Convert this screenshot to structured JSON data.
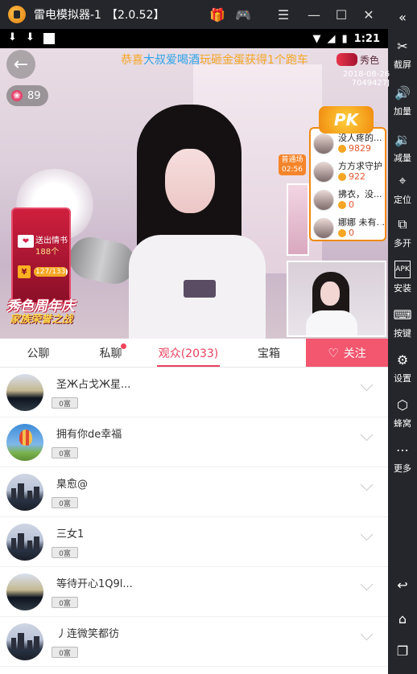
{
  "window": {
    "title": "雷电模拟器-1",
    "version": "【2.0.52】",
    "buttons": [
      "gift-icon",
      "gamepad-icon",
      "menu-icon",
      "minimize-icon",
      "maximize-icon",
      "close-icon"
    ]
  },
  "rail": {
    "items": [
      {
        "label": "截屏",
        "icon": "scissors-icon"
      },
      {
        "label": "加量",
        "icon": "volume-up-icon"
      },
      {
        "label": "减量",
        "icon": "volume-down-icon"
      },
      {
        "label": "定位",
        "icon": "location-icon"
      },
      {
        "label": "多开",
        "icon": "multi-instance-icon"
      },
      {
        "label": "安装",
        "icon": "apk-install-icon"
      },
      {
        "label": "按键",
        "icon": "keyboard-icon"
      },
      {
        "label": "设置",
        "icon": "settings-icon"
      },
      {
        "label": "蜂窝",
        "icon": "hive-icon"
      },
      {
        "label": "更多",
        "icon": "more-icon"
      }
    ],
    "nav": [
      "back-icon",
      "home-icon",
      "recents-icon"
    ]
  },
  "statusbar": {
    "time": "1:21"
  },
  "live": {
    "marquee_pre": "恭喜",
    "marquee_hl": "大叔爱喝酒",
    "marquee_post": "玩砸金蛋获得1个跑车",
    "marquee_tail": "秀色",
    "date": "2018-08-26",
    "room_code": "7049427J",
    "rose_count": "89",
    "promo": {
      "text1": "送出情书",
      "text2": "188个",
      "progress_text": "127/133",
      "progress": 0.95,
      "banner1": "秀色周年庆",
      "banner2": "家族荣誉之战"
    },
    "pk": {
      "badge": "PK",
      "putong_1": "普通场",
      "putong_2": "02:56",
      "entries": [
        {
          "name": "没人疼的...",
          "value": "9829"
        },
        {
          "name": "方方求守护",
          "value": "922"
        },
        {
          "name": "拂衣，没...",
          "value": "0"
        },
        {
          "name": "娜娜 未有...",
          "value": "0"
        }
      ]
    }
  },
  "tabs": {
    "items": [
      {
        "label": "公聊",
        "active": false
      },
      {
        "label": "私聊",
        "active": false,
        "dot": true
      },
      {
        "label": "观众(2033)",
        "active": true
      },
      {
        "label": "宝箱",
        "active": false
      }
    ],
    "follow_label": "关注"
  },
  "audience": [
    {
      "name": "圣Ж占戈Ж星...",
      "level": "0富",
      "avatar": "sunset"
    },
    {
      "name": "拥有你de幸福",
      "level": "0富",
      "avatar": "balloon"
    },
    {
      "name": "臬愈@",
      "level": "0富",
      "avatar": "city"
    },
    {
      "name": "三女1",
      "level": "0富",
      "avatar": "city"
    },
    {
      "name": "等待开心1Q9l...",
      "level": "0富",
      "avatar": "sunset"
    },
    {
      "name": "丿连微笑都彷",
      "level": "0富",
      "avatar": "city"
    }
  ]
}
